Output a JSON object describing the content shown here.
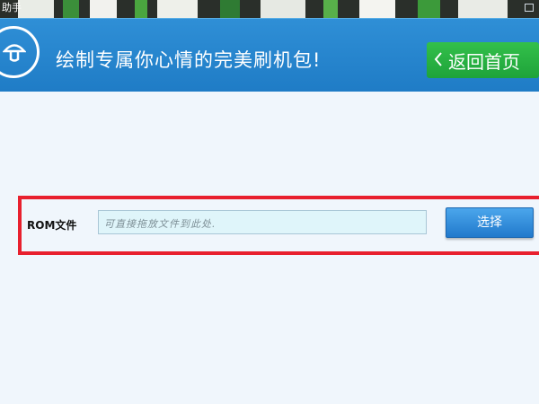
{
  "window": {
    "title": "助手"
  },
  "header": {
    "slogan": "绘制专属你心情的完美刷机包!",
    "home_button_label": "返回首页",
    "home_button_icon": "chevron-left-icon",
    "logo_icon": "mushroom-logo-icon",
    "colors": {
      "banner": "#1f7cc6",
      "home_button": "#1ea33a"
    }
  },
  "form": {
    "rom_label": "ROM文件",
    "file_input": {
      "value": "",
      "placeholder": "可直接拖放文件到此处."
    },
    "select_button_label": "选择",
    "highlight_color": "#e8202e"
  }
}
